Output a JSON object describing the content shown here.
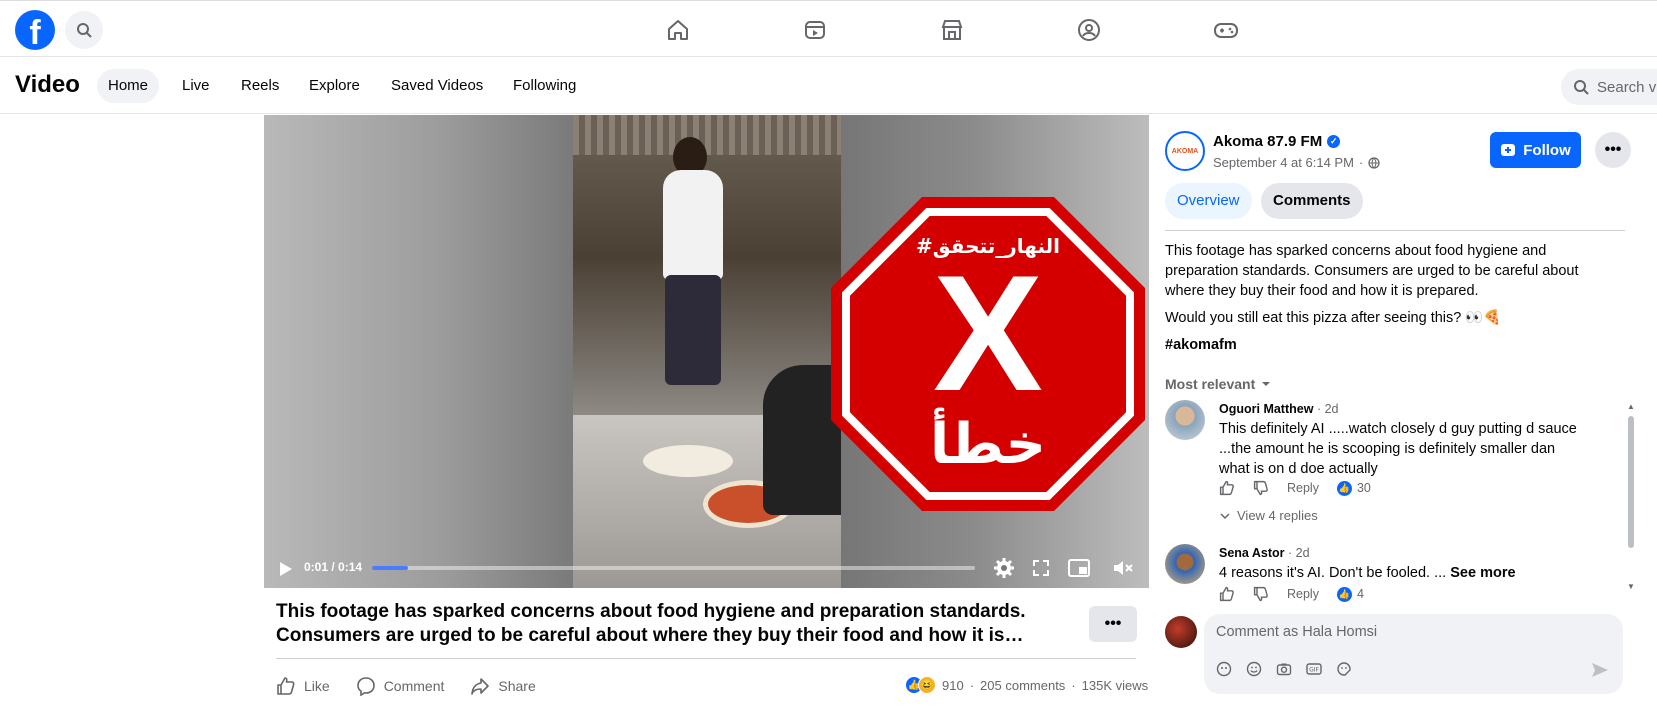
{
  "header": {
    "logo": "f",
    "nav_icons": [
      "home-icon",
      "video-icon",
      "marketplace-icon",
      "groups-icon",
      "gaming-icon"
    ]
  },
  "subnav": {
    "title": "Video",
    "tabs": [
      "Home",
      "Live",
      "Reels",
      "Explore",
      "Saved Videos",
      "Following"
    ],
    "active_tab": "Home",
    "search_placeholder": "Search vid"
  },
  "video": {
    "time": "0:01 / 0:14",
    "progress": 0.06,
    "overlay_tag": "#النهار_تتحقق",
    "overlay_mark": "X",
    "overlay_word": "خطأ",
    "caption_line1": "This footage has sparked concerns about food hygiene and preparation standards.",
    "caption_line2": "Consumers are urged to be careful about where they buy their food and how it is…",
    "actions": {
      "like": "Like",
      "comment": "Comment",
      "share": "Share"
    },
    "stats": {
      "reactions": "910",
      "comments": "205 comments",
      "views": "135K views"
    }
  },
  "sidebar": {
    "page_name": "Akoma 87.9 FM",
    "page_avatar_text": "AKOMA",
    "post_date": "September 4 at 6:14 PM",
    "follow": "Follow",
    "tabs": [
      "Overview",
      "Comments"
    ],
    "description": [
      "This footage has sparked concerns about food hygiene and preparation standards. Consumers are urged to be careful about where they buy their food and how it is prepared.",
      "Would you still eat this pizza after seeing this? 👀🍕"
    ],
    "hashtag": "#akomafm",
    "sort_label": "Most relevant",
    "comments": [
      {
        "name": "Oguori Matthew",
        "age": "2d",
        "text": "This definitely AI .....watch closely d guy putting d sauce ...the amount he is scooping is definitely smaller dan what is on d doe actually",
        "reply": "Reply",
        "likes": "30",
        "view_replies": "View 4 replies"
      },
      {
        "name": "Sena Astor",
        "age": "2d",
        "text": "4 reasons it's AI. Don't be fooled. ...",
        "see_more": "See more",
        "reply": "Reply",
        "likes": "4"
      }
    ],
    "composer_placeholder": "Comment as Hala Homsi"
  },
  "colors": {
    "brand": "#0866ff",
    "stop_red": "#d40000"
  }
}
